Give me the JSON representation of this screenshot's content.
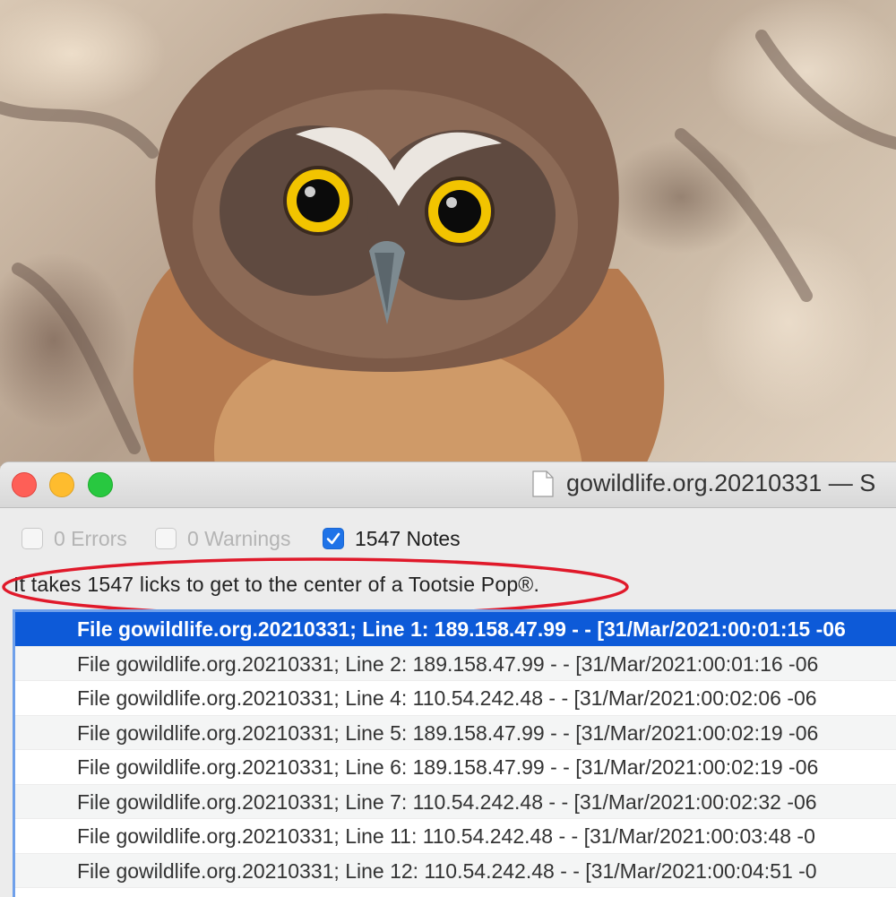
{
  "photo": {
    "subject": "owl-photo"
  },
  "window": {
    "title": "gowildlife.org.20210331 — S"
  },
  "filters": [
    {
      "label": "0 Errors",
      "checked": false
    },
    {
      "label": "0 Warnings",
      "checked": false
    },
    {
      "label": "1547 Notes",
      "checked": true
    }
  ],
  "message": "It takes 1547 licks to get to the center of a Tootsie Pop®.",
  "log_rows": [
    "File gowildlife.org.20210331; Line 1: 189.158.47.99 - - [31/Mar/2021:00:01:15 -06",
    "File gowildlife.org.20210331; Line 2: 189.158.47.99 - - [31/Mar/2021:00:01:16 -06",
    "File gowildlife.org.20210331; Line 4: 110.54.242.48 - - [31/Mar/2021:00:02:06 -06",
    "File gowildlife.org.20210331; Line 5: 189.158.47.99 - - [31/Mar/2021:00:02:19 -06",
    "File gowildlife.org.20210331; Line 6: 189.158.47.99 - - [31/Mar/2021:00:02:19 -06",
    "File gowildlife.org.20210331; Line 7: 110.54.242.48 - - [31/Mar/2021:00:02:32 -06",
    "File gowildlife.org.20210331; Line 11: 110.54.242.48 - - [31/Mar/2021:00:03:48 -0",
    "File gowildlife.org.20210331; Line 12: 110.54.242.48 - - [31/Mar/2021:00:04:51 -0"
  ],
  "selected_row": 0,
  "colors": {
    "selection": "#0d5ad8",
    "highlight_ellipse": "#e0192a",
    "checkbox_on": "#1f73e8"
  }
}
